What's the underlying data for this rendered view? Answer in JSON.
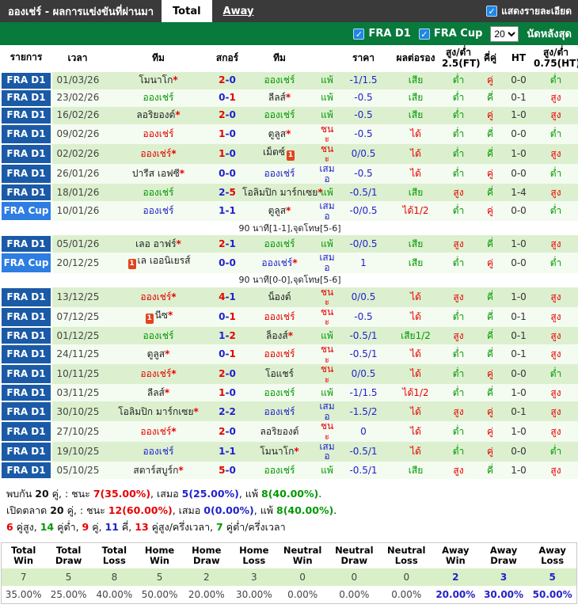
{
  "header": {
    "title": "อองเช่ร์ - ผลการแข่งขันที่ผ่านมา",
    "tabs": [
      {
        "label": "Total",
        "active": true
      },
      {
        "label": "Away",
        "active": false
      }
    ],
    "detail_checkbox_label": "แสดงรายละเอียด",
    "detail_checkbox_checked": true
  },
  "filterbar": {
    "leagues": [
      {
        "label": "FRA D1",
        "checked": true
      },
      {
        "label": "FRA Cup",
        "checked": true
      }
    ],
    "match_count": "20",
    "match_count_suffix": "นัดหลังสุด"
  },
  "colors": {
    "red": "#e60000",
    "blue": "#2222cc",
    "green": "#009900",
    "win": "#e60000",
    "draw": "#2222cc",
    "loss": "#009900",
    "opp": "#222222",
    "fra_d1_bg": "#1b5aa6",
    "fra_cup_bg": "#2d7de2",
    "row_green": "#dcf0cf",
    "row_pale": "#f4fbf0",
    "bar_green": "#087a3c",
    "bar_dark": "#3a3a3a"
  },
  "table": {
    "headers": [
      "รายการ",
      "เวลา",
      "ทีม",
      "สกอร์",
      "ทีม",
      "",
      "ราคา",
      "ผลต่อรอง",
      "สูง/ต่ำ 2.5(FT)",
      "คี่คู่",
      "HT",
      "สูง/ต่ำ 0.75(HT)"
    ],
    "rows": [
      {
        "league": "FRA D1",
        "cup": false,
        "date": "01/03/26",
        "home": {
          "name": "โมนาโก",
          "star": true,
          "result": "opp"
        },
        "score": "2-0",
        "away": {
          "name": "อองเช่ร์",
          "star": false,
          "result": "loss"
        },
        "outcome": "แพ้",
        "handicap": "-1/1.5",
        "handicap_result": "เสีย",
        "over_under": "ต่ำ",
        "odd_even": "คู่",
        "ht": "0-0",
        "ht_over_under": "ต่ำ"
      },
      {
        "league": "FRA D1",
        "cup": false,
        "date": "23/02/26",
        "home": {
          "name": "อองเช่ร์",
          "star": false,
          "result": "loss"
        },
        "score": "0-1",
        "away": {
          "name": "ลีลส์",
          "star": true,
          "result": "opp"
        },
        "outcome": "แพ้",
        "handicap": "-0.5",
        "handicap_result": "เสีย",
        "over_under": "ต่ำ",
        "odd_even": "คี่",
        "ht": "0-1",
        "ht_over_under": "สูง"
      },
      {
        "league": "FRA D1",
        "cup": false,
        "date": "16/02/26",
        "home": {
          "name": "ลอริยองต์",
          "star": true,
          "result": "opp"
        },
        "score": "2-0",
        "away": {
          "name": "อองเช่ร์",
          "star": false,
          "result": "loss"
        },
        "outcome": "แพ้",
        "handicap": "-0.5",
        "handicap_result": "เสีย",
        "over_under": "ต่ำ",
        "odd_even": "คู่",
        "ht": "1-0",
        "ht_over_under": "สูง"
      },
      {
        "league": "FRA D1",
        "cup": false,
        "date": "09/02/26",
        "home": {
          "name": "อองเช่ร์",
          "star": false,
          "result": "win"
        },
        "score": "1-0",
        "away": {
          "name": "ตูลูส",
          "star": true,
          "result": "opp"
        },
        "outcome": "ชนะ",
        "handicap": "-0.5",
        "handicap_result": "ได้",
        "over_under": "ต่ำ",
        "odd_even": "คี่",
        "ht": "0-0",
        "ht_over_under": "ต่ำ"
      },
      {
        "league": "FRA D1",
        "cup": false,
        "date": "02/02/26",
        "home": {
          "name": "อองเช่ร์",
          "star": true,
          "result": "win"
        },
        "score": "1-0",
        "away": {
          "name": "เม็ตซ์",
          "star": false,
          "result": "opp",
          "card": "post"
        },
        "outcome": "ชนะ",
        "handicap": "0/0.5",
        "handicap_result": "ได้",
        "over_under": "ต่ำ",
        "odd_even": "คี่",
        "ht": "1-0",
        "ht_over_under": "สูง"
      },
      {
        "league": "FRA D1",
        "cup": false,
        "date": "26/01/26",
        "home": {
          "name": "ปารีส เอฟซี",
          "star": true,
          "result": "opp"
        },
        "score": "0-0",
        "away": {
          "name": "อองเช่ร์",
          "star": false,
          "result": "draw"
        },
        "outcome": "เสมอ",
        "handicap": "-0.5",
        "handicap_result": "ได้",
        "over_under": "ต่ำ",
        "odd_even": "คู่",
        "ht": "0-0",
        "ht_over_under": "ต่ำ"
      },
      {
        "league": "FRA D1",
        "cup": false,
        "date": "18/01/26",
        "home": {
          "name": "อองเช่ร์",
          "star": false,
          "result": "loss"
        },
        "score": "2-5",
        "away": {
          "name": "โอลิมปิก มาร์กเซย",
          "star": true,
          "result": "opp"
        },
        "outcome": "แพ้",
        "handicap": "-0.5/1",
        "handicap_result": "เสีย",
        "over_under": "สูง",
        "odd_even": "คี่",
        "ht": "1-4",
        "ht_over_under": "สูง"
      },
      {
        "league": "FRA Cup",
        "cup": true,
        "date": "10/01/26",
        "home": {
          "name": "อองเช่ร์",
          "star": false,
          "result": "draw"
        },
        "score": "1-1",
        "away": {
          "name": "ตูลูส",
          "star": true,
          "result": "opp"
        },
        "outcome": "เสมอ",
        "handicap": "-0/0.5",
        "handicap_result": "ได้1/2",
        "over_under": "ต่ำ",
        "odd_even": "คู่",
        "ht": "0-0",
        "ht_over_under": "ต่ำ",
        "note": "90 นาที[1-1],จุดโทษ[5-6]"
      },
      {
        "league": "FRA D1",
        "cup": false,
        "date": "05/01/26",
        "home": {
          "name": "เลอ อาฟร์",
          "star": true,
          "result": "opp"
        },
        "score": "2-1",
        "away": {
          "name": "อองเช่ร์",
          "star": false,
          "result": "loss"
        },
        "outcome": "แพ้",
        "handicap": "-0/0.5",
        "handicap_result": "เสีย",
        "over_under": "สูง",
        "odd_even": "คี่",
        "ht": "1-0",
        "ht_over_under": "สูง"
      },
      {
        "league": "FRA Cup",
        "cup": true,
        "date": "20/12/25",
        "home": {
          "name": "เล เออนิเยรส์",
          "star": false,
          "result": "opp",
          "card": "pre"
        },
        "score": "0-0",
        "away": {
          "name": "อองเช่ร์",
          "star": true,
          "result": "draw"
        },
        "outcome": "เสมอ",
        "handicap": "1",
        "handicap_result": "เสีย",
        "over_under": "ต่ำ",
        "odd_even": "คู่",
        "ht": "0-0",
        "ht_over_under": "ต่ำ",
        "note": "90 นาที[0-0],จุดโทษ[5-6]"
      },
      {
        "league": "FRA D1",
        "cup": false,
        "date": "13/12/25",
        "home": {
          "name": "อองเช่ร์",
          "star": true,
          "result": "win"
        },
        "score": "4-1",
        "away": {
          "name": "น็องต์",
          "star": false,
          "result": "opp"
        },
        "outcome": "ชนะ",
        "handicap": "0/0.5",
        "handicap_result": "ได้",
        "over_under": "สูง",
        "odd_even": "คี่",
        "ht": "1-0",
        "ht_over_under": "สูง"
      },
      {
        "league": "FRA D1",
        "cup": false,
        "date": "07/12/25",
        "home": {
          "name": "นีซ",
          "star": true,
          "result": "opp",
          "card": "pre"
        },
        "score": "0-1",
        "away": {
          "name": "อองเช่ร์",
          "star": false,
          "result": "win"
        },
        "outcome": "ชนะ",
        "handicap": "-0.5",
        "handicap_result": "ได้",
        "over_under": "ต่ำ",
        "odd_even": "คี่",
        "ht": "0-1",
        "ht_over_under": "สูง"
      },
      {
        "league": "FRA D1",
        "cup": false,
        "date": "01/12/25",
        "home": {
          "name": "อองเช่ร์",
          "star": false,
          "result": "loss"
        },
        "score": "1-2",
        "away": {
          "name": "ล็องส์",
          "star": true,
          "result": "opp"
        },
        "outcome": "แพ้",
        "handicap": "-0.5/1",
        "handicap_result": "เสีย1/2",
        "over_under": "สูง",
        "odd_even": "คี่",
        "ht": "0-1",
        "ht_over_under": "สูง"
      },
      {
        "league": "FRA D1",
        "cup": false,
        "date": "24/11/25",
        "home": {
          "name": "ตูลูส",
          "star": true,
          "result": "opp"
        },
        "score": "0-1",
        "away": {
          "name": "อองเช่ร์",
          "star": false,
          "result": "win"
        },
        "outcome": "ชนะ",
        "handicap": "-0.5/1",
        "handicap_result": "ได้",
        "over_under": "ต่ำ",
        "odd_even": "คี่",
        "ht": "0-1",
        "ht_over_under": "สูง"
      },
      {
        "league": "FRA D1",
        "cup": false,
        "date": "10/11/25",
        "home": {
          "name": "อองเช่ร์",
          "star": true,
          "result": "win"
        },
        "score": "2-0",
        "away": {
          "name": "โอแชร์",
          "star": false,
          "result": "opp"
        },
        "outcome": "ชนะ",
        "handicap": "0/0.5",
        "handicap_result": "ได้",
        "over_under": "ต่ำ",
        "odd_even": "คู่",
        "ht": "0-0",
        "ht_over_under": "ต่ำ"
      },
      {
        "league": "FRA D1",
        "cup": false,
        "date": "03/11/25",
        "home": {
          "name": "ลีลส์",
          "star": true,
          "result": "opp"
        },
        "score": "1-0",
        "away": {
          "name": "อองเช่ร์",
          "star": false,
          "result": "loss"
        },
        "outcome": "แพ้",
        "handicap": "-1/1.5",
        "handicap_result": "ได้1/2",
        "over_under": "ต่ำ",
        "odd_even": "คี่",
        "ht": "1-0",
        "ht_over_under": "สูง"
      },
      {
        "league": "FRA D1",
        "cup": false,
        "date": "30/10/25",
        "home": {
          "name": "โอลิมปิก มาร์กเซย",
          "star": true,
          "result": "opp"
        },
        "score": "2-2",
        "away": {
          "name": "อองเช่ร์",
          "star": false,
          "result": "draw"
        },
        "outcome": "เสมอ",
        "handicap": "-1.5/2",
        "handicap_result": "ได้",
        "over_under": "สูง",
        "odd_even": "คู่",
        "ht": "0-1",
        "ht_over_under": "สูง"
      },
      {
        "league": "FRA D1",
        "cup": false,
        "date": "27/10/25",
        "home": {
          "name": "อองเช่ร์",
          "star": true,
          "result": "win"
        },
        "score": "2-0",
        "away": {
          "name": "ลอริยองต์",
          "star": false,
          "result": "opp"
        },
        "outcome": "ชนะ",
        "handicap": "0",
        "handicap_result": "ได้",
        "over_under": "ต่ำ",
        "odd_even": "คู่",
        "ht": "1-0",
        "ht_over_under": "สูง"
      },
      {
        "league": "FRA D1",
        "cup": false,
        "date": "19/10/25",
        "home": {
          "name": "อองเช่ร์",
          "star": false,
          "result": "draw"
        },
        "score": "1-1",
        "away": {
          "name": "โมนาโก",
          "star": true,
          "result": "opp"
        },
        "outcome": "เสมอ",
        "handicap": "-0.5/1",
        "handicap_result": "ได้",
        "over_under": "ต่ำ",
        "odd_even": "คู่",
        "ht": "0-0",
        "ht_over_under": "ต่ำ"
      },
      {
        "league": "FRA D1",
        "cup": false,
        "date": "05/10/25",
        "home": {
          "name": "สตาร์สบูร์ก",
          "star": true,
          "result": "opp"
        },
        "score": "5-0",
        "away": {
          "name": "อองเช่ร์",
          "star": false,
          "result": "loss"
        },
        "outcome": "แพ้",
        "handicap": "-0.5/1",
        "handicap_result": "เสีย",
        "over_under": "สูง",
        "odd_even": "คี่",
        "ht": "1-0",
        "ht_over_under": "สูง"
      }
    ]
  },
  "summary": {
    "lines": [
      [
        {
          "t": "พบกัน "
        },
        {
          "t": "20",
          "b": true
        },
        {
          "t": " คู่, : ชนะ "
        },
        {
          "t": "7(35.00%)",
          "c": "red",
          "b": true
        },
        {
          "t": ", เสมอ "
        },
        {
          "t": "5(25.00%)",
          "c": "blue",
          "b": true
        },
        {
          "t": ", แพ้ "
        },
        {
          "t": "8(40.00%)",
          "c": "green",
          "b": true
        },
        {
          "t": "."
        }
      ],
      [
        {
          "t": "เปิดตลาด "
        },
        {
          "t": "20",
          "b": true
        },
        {
          "t": " คู่, : ชนะ "
        },
        {
          "t": "12(60.00%)",
          "c": "red",
          "b": true
        },
        {
          "t": ", เสมอ "
        },
        {
          "t": "0(0.00%)",
          "c": "blue",
          "b": true
        },
        {
          "t": ", แพ้ "
        },
        {
          "t": "8(40.00%)",
          "c": "green",
          "b": true
        },
        {
          "t": "."
        }
      ],
      [
        {
          "t": "6",
          "c": "red",
          "b": true
        },
        {
          "t": " คู่สูง, "
        },
        {
          "t": "14",
          "c": "green",
          "b": true
        },
        {
          "t": " คู่ต่ำ, "
        },
        {
          "t": "9",
          "c": "red",
          "b": true
        },
        {
          "t": " คู่, "
        },
        {
          "t": "11",
          "c": "blue",
          "b": true
        },
        {
          "t": " คี่, "
        },
        {
          "t": "13",
          "c": "red",
          "b": true
        },
        {
          "t": " คู่สูง/ครึ่งเวลา, "
        },
        {
          "t": "7",
          "c": "green",
          "b": true
        },
        {
          "t": " คู่ต่ำ/ครึ่งเวลา"
        }
      ]
    ]
  },
  "stats_table": {
    "headers": [
      "Total Win",
      "Total Draw",
      "Total Loss",
      "Home Win",
      "Home Draw",
      "Home Loss",
      "Neutral Win",
      "Neutral Draw",
      "Neutral Loss",
      "Away Win",
      "Away Draw",
      "Away Loss"
    ],
    "counts": [
      "7",
      "5",
      "8",
      "5",
      "2",
      "3",
      "0",
      "0",
      "0",
      "2",
      "3",
      "5"
    ],
    "percents": [
      "35.00%",
      "25.00%",
      "40.00%",
      "50.00%",
      "20.00%",
      "30.00%",
      "0.00%",
      "0.00%",
      "0.00%",
      "20.00%",
      "30.00%",
      "50.00%"
    ],
    "away_highlight_from": 9
  }
}
